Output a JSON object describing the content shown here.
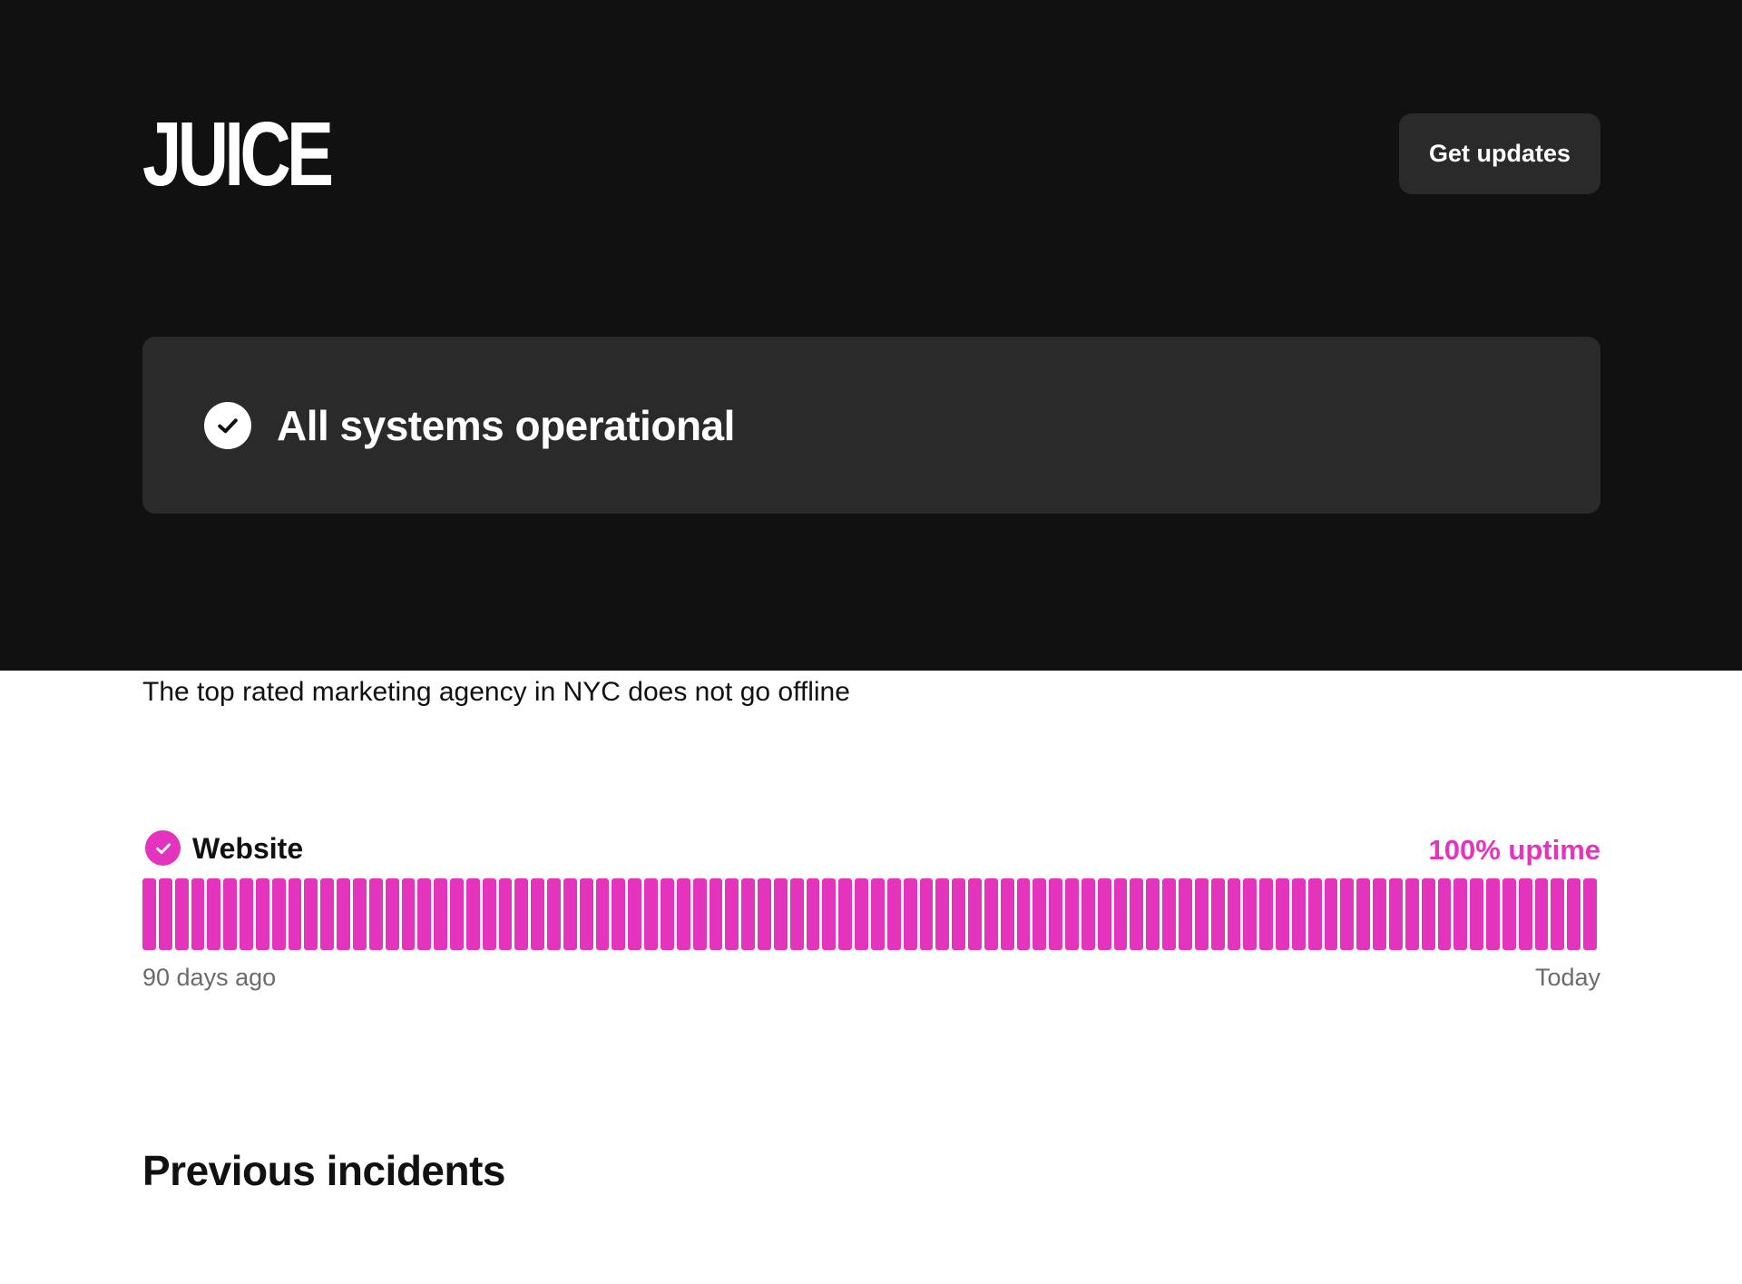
{
  "brand": {
    "logo_text": "JUICE"
  },
  "header": {
    "get_updates_label": "Get updates"
  },
  "status": {
    "message": "All systems operational",
    "icon": "check-circle-icon"
  },
  "tagline": "The top rated marketing agency in NYC does not go offline",
  "components": [
    {
      "name": "Website",
      "icon": "check-circle-icon",
      "uptime_label": "100% uptime",
      "uptime_percent": 100,
      "days": 90,
      "status": "operational",
      "range_start_label": "90 days ago",
      "range_end_label": "Today"
    }
  ],
  "incidents": {
    "title": "Previous incidents"
  },
  "colors": {
    "hero_background": "#111111",
    "card_background": "#2a2a2a",
    "accent": "#e434be",
    "muted_text": "#6b6b6b"
  }
}
